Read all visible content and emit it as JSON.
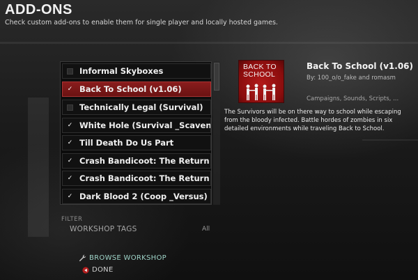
{
  "header": {
    "title": "ADD-ONS",
    "subtitle": "Check custom add-ons to enable them for single player and locally hosted games."
  },
  "addons": [
    {
      "label": "Informal Skyboxes",
      "checked": false,
      "selected": false
    },
    {
      "label": "Back To School (v1.06)",
      "checked": true,
      "selected": true
    },
    {
      "label": "Technically Legal (Survival)",
      "checked": false,
      "selected": false
    },
    {
      "label": "White Hole (Survival _Scavenge",
      "checked": true,
      "selected": false
    },
    {
      "label": "Till Death Do Us Part",
      "checked": true,
      "selected": false
    },
    {
      "label": "Crash Bandicoot: The Return o",
      "checked": true,
      "selected": false
    },
    {
      "label": "Crash Bandicoot: The Return o",
      "checked": true,
      "selected": false
    },
    {
      "label": "Dark Blood 2 (Coop _Versus)",
      "checked": true,
      "selected": false
    }
  ],
  "details": {
    "thumbnail_text": "BACK TO SCHOOL",
    "title": "Back To School (v1.06)",
    "by": "By: 100_o/o_fake and romasm",
    "tags": "Campaigns, Sounds, Scripts, ...",
    "description": "The Survivors will be on there way to school while escaping from the bloody infected. Battle hordes of zombies in six detailed environments while traveling Back to School."
  },
  "filter": {
    "label": "FILTER",
    "workshop_tags_label": "WORKSHOP TAGS",
    "workshop_tags_value": "All"
  },
  "buttons": {
    "browse_workshop": "BROWSE WORKSHOP",
    "done": "DONE"
  },
  "icons": {
    "browse": "wrench-icon",
    "done": "back-arrow-icon"
  },
  "colors": {
    "selected_row": "#7a1616",
    "browse_text": "#9fd4c8",
    "thumbnail_red": "#b21a1a"
  }
}
